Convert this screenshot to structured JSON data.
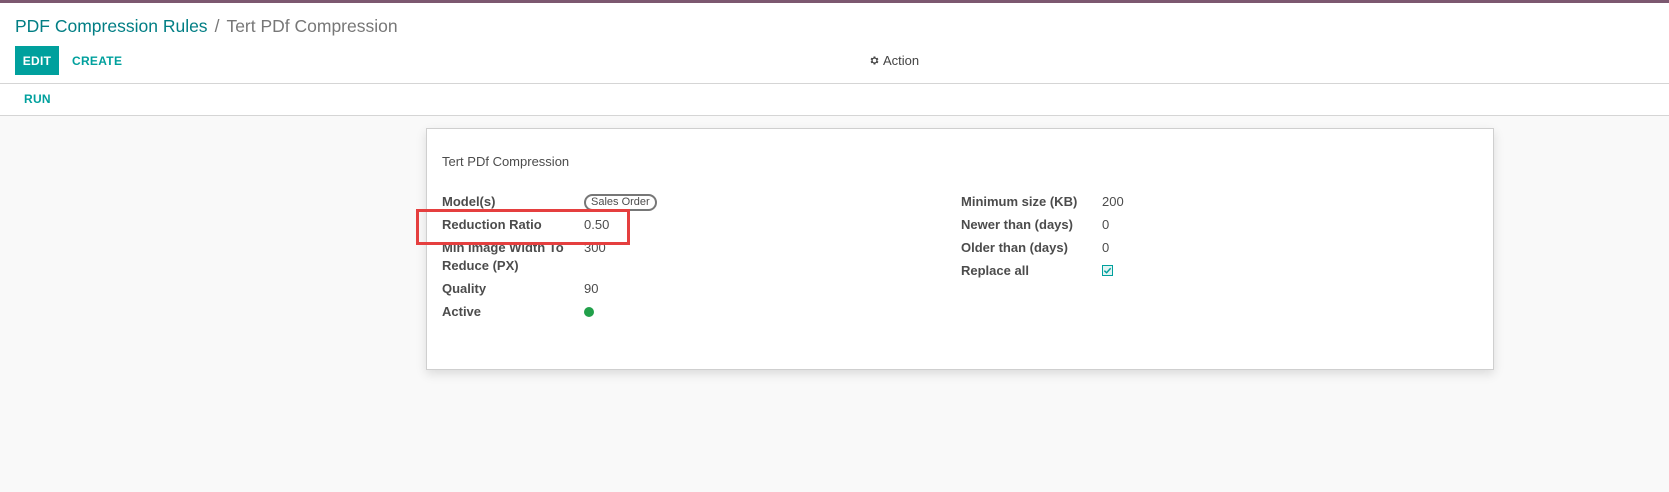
{
  "breadcrumb": {
    "parent": "PDF Compression Rules",
    "separator": "/",
    "current": "Tert PDf Compression"
  },
  "toolbar": {
    "edit_label": "EDIT",
    "create_label": "CREATE",
    "action_label": "Action",
    "action_icon": "gear-icon"
  },
  "statusbar": {
    "run_label": "RUN"
  },
  "record": {
    "title": "Tert PDf Compression",
    "left_fields": {
      "models_label": "Model(s)",
      "models_tag": "Sales Order",
      "reduction_label": "Reduction Ratio",
      "reduction_value": "0.50",
      "min_width_label_line1": "Min Image Width To",
      "min_width_label_line2": "Reduce (PX)",
      "min_width_value": "300",
      "quality_label": "Quality",
      "quality_value": "90",
      "active_label": "Active",
      "active_color": "#21a04a"
    },
    "right_fields": {
      "min_size_label": "Minimum size (KB)",
      "min_size_value": "200",
      "newer_label": "Newer than (days)",
      "newer_value": "0",
      "older_label": "Older than (days)",
      "older_value": "0",
      "replace_label": "Replace all",
      "replace_checked": true
    }
  },
  "colors": {
    "accent": "#00a09d",
    "link": "#017e84",
    "highlight": "#e53f3f",
    "top_bar": "#7c5870"
  }
}
